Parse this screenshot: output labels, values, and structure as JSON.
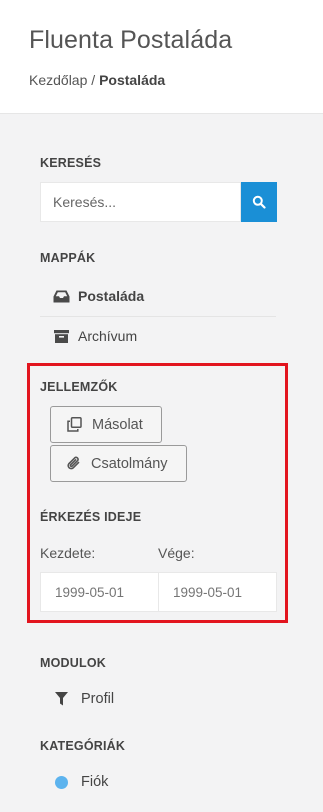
{
  "header": {
    "title": "Fluenta Postaláda",
    "breadcrumb": {
      "home": "Kezdőlap",
      "separator": " / ",
      "current": "Postaláda"
    }
  },
  "search": {
    "heading": "KERESÉS",
    "placeholder": "Keresés...",
    "button_icon": "search-icon"
  },
  "folders": {
    "heading": "MAPPÁK",
    "items": [
      {
        "label": "Postaláda",
        "icon": "inbox-icon",
        "active": true
      },
      {
        "label": "Archívum",
        "icon": "archive-icon",
        "active": false
      }
    ]
  },
  "features": {
    "heading": "JELLEMZŐK",
    "buttons": [
      {
        "label": "Másolat",
        "icon": "copy-icon"
      },
      {
        "label": "Csatolmány",
        "icon": "paperclip-icon"
      }
    ]
  },
  "arrival": {
    "heading": "ÉRKEZÉS IDEJE",
    "from_label": "Kezdete:",
    "to_label": "Vége:",
    "from_placeholder": "1999-05-01",
    "to_placeholder": "1999-05-01"
  },
  "modules": {
    "heading": "MODULOK",
    "items": [
      {
        "label": "Profil",
        "icon": "filter-icon"
      }
    ]
  },
  "categories": {
    "heading": "KATEGÓRIÁK",
    "items": [
      {
        "label": "Fiók",
        "color": "#5cb3ee"
      }
    ]
  },
  "colors": {
    "accent": "#1a8fd6",
    "highlight": "#e2141e"
  }
}
